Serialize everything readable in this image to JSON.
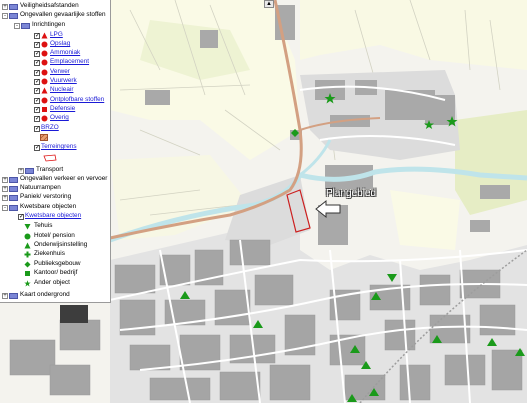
{
  "map": {
    "plan_label": "Plangebied",
    "colors": {
      "street": "#8d8d8d",
      "road_area": "#c4c4c4",
      "field": "#fafae6",
      "green": "#e4ebc3",
      "water": "#bfe4ea",
      "main_road": "#d3a082",
      "boundary": "#cc1f1f",
      "symbol_green": "#1a9a1a"
    }
  },
  "layers": {
    "items": [
      {
        "label": "Veiligheidsafstanden",
        "expander": "+",
        "icon": "folder"
      },
      {
        "label": "Ongevallen gevaarlijke stoffen",
        "expander": "-",
        "icon": "folder"
      },
      {
        "label": "Inrichtingen",
        "expander": "-",
        "icon": "folder"
      },
      {
        "label": "LPG",
        "symbol": "red-triangle"
      },
      {
        "label": "Opslag",
        "symbol": "red-circle"
      },
      {
        "label": "Ammoniak",
        "symbol": "red-circle"
      },
      {
        "label": "Emplacement",
        "symbol": "red-circle"
      },
      {
        "label": "Verwer",
        "symbol": "red-circle"
      },
      {
        "label": "Vuurwerk",
        "symbol": "red-circle"
      },
      {
        "label": "Nucleair",
        "symbol": "red-triangle"
      },
      {
        "label": "Ontplofbare stoffen",
        "symbol": "red-circle"
      },
      {
        "label": "Defensie",
        "symbol": "red-square"
      },
      {
        "label": "Overig",
        "symbol": "red-circle"
      },
      {
        "label": "BRZO",
        "symbol": "none"
      },
      {
        "label": "Terreingrens",
        "symbol": "none"
      },
      {
        "label": "Transport",
        "expander": "+",
        "icon": "folder"
      },
      {
        "label": "Ongevallen verkeer en vervoer",
        "expander": "+",
        "icon": "folder"
      },
      {
        "label": "Natuurrampen",
        "expander": "+",
        "icon": "folder"
      },
      {
        "label": "Paniek/ verstoring",
        "expander": "+",
        "icon": "folder"
      },
      {
        "label": "Kwetsbare objecten",
        "expander": "-",
        "icon": "folder"
      },
      {
        "label": "Kwetsbare objecten",
        "symbol": "none"
      }
    ],
    "legend": [
      {
        "label": "Tehuis",
        "symbol": "green-triangle-down"
      },
      {
        "label": "Hotel/ pension",
        "symbol": "green-circle"
      },
      {
        "label": "Onderwijsinstelling",
        "symbol": "green-triangle"
      },
      {
        "label": "Ziekenhuis",
        "symbol": "green-plus"
      },
      {
        "label": "Publieksgebouw",
        "symbol": "green-diamond"
      },
      {
        "label": "Kantoor/ bedrijf",
        "symbol": "green-square"
      },
      {
        "label": "Ander object",
        "symbol": "green-star"
      }
    ],
    "footer": {
      "label": "Kaart ondergrond",
      "expander": "+",
      "icon": "folder"
    }
  }
}
